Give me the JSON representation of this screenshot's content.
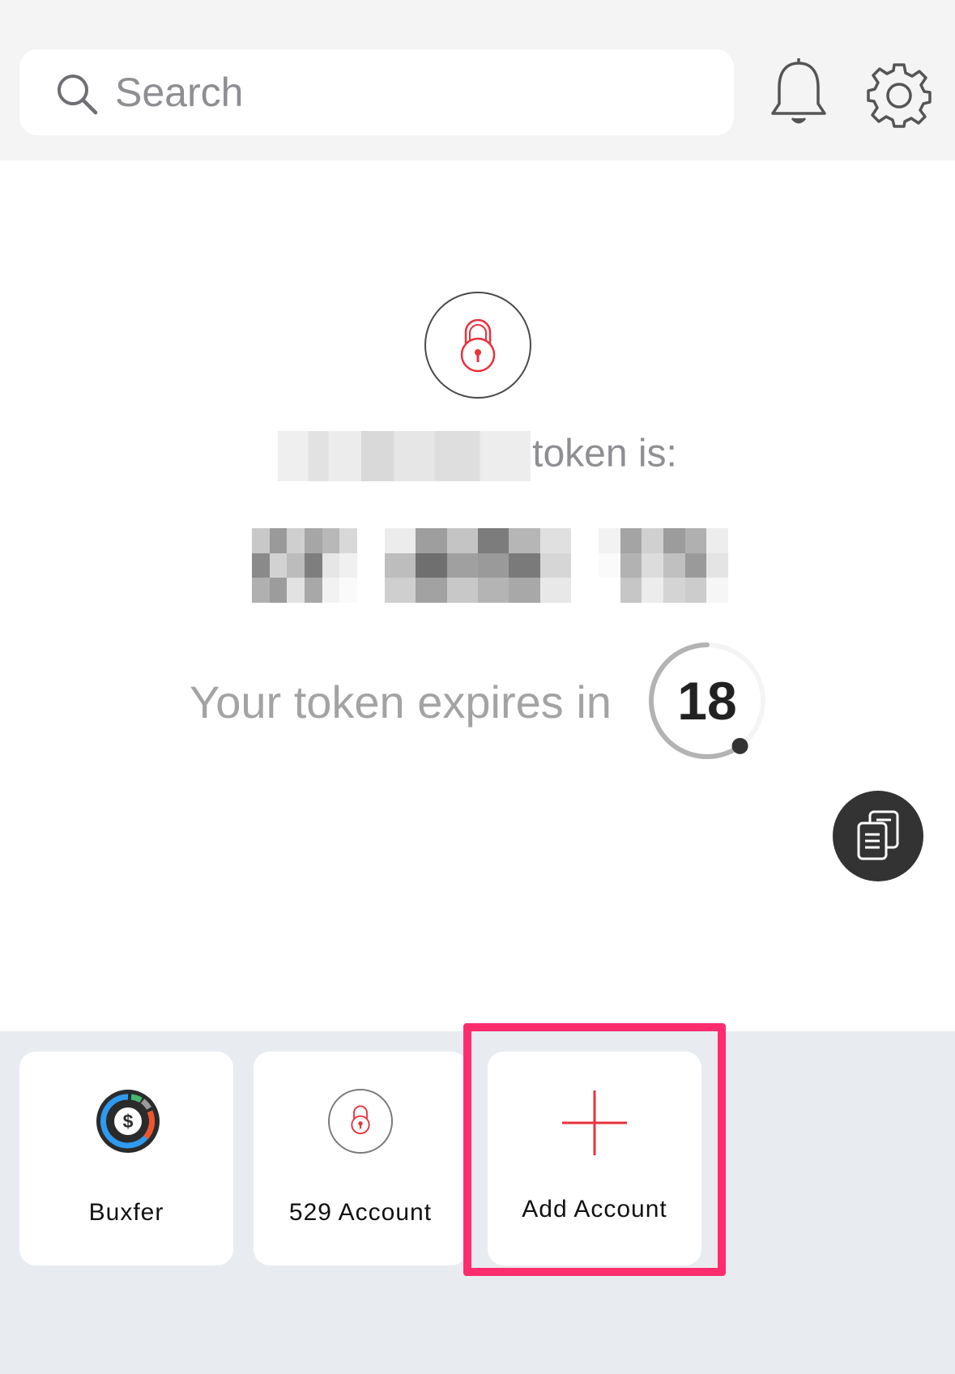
{
  "search": {
    "placeholder": "Search",
    "icon": "search-icon"
  },
  "header": {
    "notifications_icon": "bell-icon",
    "settings_icon": "gear-icon"
  },
  "token": {
    "label_suffix": "token is:",
    "expires_label": "Your token expires in",
    "countdown_seconds": "18",
    "countdown_remaining_fraction": 0.6
  },
  "colors": {
    "accent_red": "#e8323c",
    "highlight_pink": "#ff2d6e",
    "dark_button": "#333333"
  },
  "accounts": [
    {
      "name": "Buxfer",
      "icon": "buxfer-dollar-icon"
    },
    {
      "name": "529 Account",
      "icon": "lock-icon"
    },
    {
      "name": "Add Account",
      "icon": "plus-icon"
    }
  ]
}
